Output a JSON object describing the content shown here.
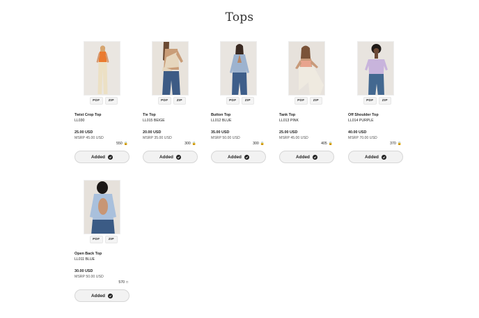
{
  "page": {
    "title": "Tops"
  },
  "labels": {
    "pdf": "PDF",
    "zip": "ZIP",
    "added": "Added"
  },
  "products": [
    {
      "name": "Twist Crop Top",
      "sku": "LL030",
      "price": "25.00 USD",
      "msrp": "MSRP 45.00 USD",
      "stock": "550",
      "stock_icon": "lock-icon"
    },
    {
      "name": "Tie Top",
      "sku": "LL015 BEIGE",
      "price": "20.00 USD",
      "msrp": "MSRP 35.00 USD",
      "stock": "300",
      "stock_icon": "lock-icon"
    },
    {
      "name": "Button Top",
      "sku": "LL012 BLUE",
      "price": "35.00 USD",
      "msrp": "MSRP 50.00 USD",
      "stock": "300",
      "stock_icon": "lock-icon"
    },
    {
      "name": "Tank Top",
      "sku": "LL013 PINK",
      "price": "25.00 USD",
      "msrp": "MSRP 45.00 USD",
      "stock": "405",
      "stock_icon": "lock-icon"
    },
    {
      "name": "Off Shoulder Top",
      "sku": "LL014 PURPLE",
      "price": "40.00 USD",
      "msrp": "MSRP 70.00 USD",
      "stock": "370",
      "stock_icon": "lock-icon"
    },
    {
      "name": "Open Back Top",
      "sku": "LL011 BLUE",
      "price": "30.00 USD",
      "msrp": "MSRP 50.00 USD",
      "stock": "570",
      "stock_icon": "box-icon"
    }
  ]
}
